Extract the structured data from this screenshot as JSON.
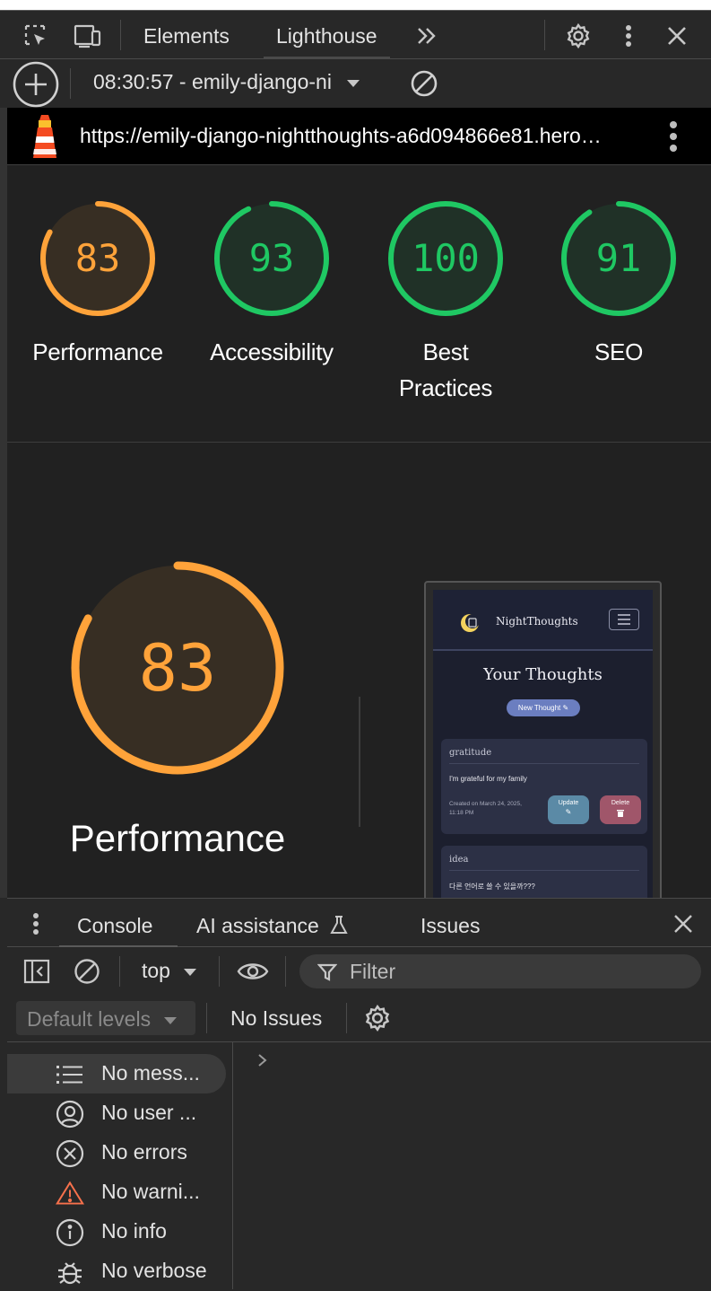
{
  "toolbar": {
    "tabs": [
      "Elements",
      "Lighthouse"
    ],
    "active_tab": "Lighthouse",
    "more_tabs": "»"
  },
  "report_bar": {
    "selected_report": "08:30:57 - emily-django-ni"
  },
  "url_bar": {
    "url": "https://emily-django-nightthoughts-a6d094866e81.hero…"
  },
  "scores": [
    {
      "value": 83,
      "label": "Performance",
      "color": "#ffa33a"
    },
    {
      "value": 93,
      "label": "Accessibility",
      "color": "#1fc863"
    },
    {
      "value": 100,
      "label": "Best Practices",
      "color": "#1fc863"
    },
    {
      "value": 91,
      "label": "SEO",
      "color": "#1fc863"
    }
  ],
  "featured": {
    "value": 83,
    "label": "Performance",
    "color": "#ffa33a"
  },
  "page_screenshot": {
    "brand": "NightThoughts",
    "title": "Your Thoughts",
    "new_button": "New Thought",
    "cards": [
      {
        "tag": "gratitude",
        "body": "I'm grateful for my family",
        "meta": "Created on March 24, 2025, 11:18 PM",
        "update_label": "Update",
        "delete_label": "Delete"
      },
      {
        "tag": "idea",
        "body": "다른 언어로 쓸 수 있을까???"
      }
    ]
  },
  "drawer": {
    "tabs": [
      "Console",
      "AI assistance",
      "Issues"
    ],
    "active_tab": "Console"
  },
  "console": {
    "context": "top",
    "filter_placeholder": "Filter",
    "levels": "Default levels",
    "issues": "No Issues",
    "prompt": ">",
    "sidebar": [
      {
        "label": "No mess...",
        "icon": "list-icon"
      },
      {
        "label": "No user ...",
        "icon": "user-icon"
      },
      {
        "label": "No errors",
        "icon": "error-icon"
      },
      {
        "label": "No warni...",
        "icon": "warning-icon"
      },
      {
        "label": "No info",
        "icon": "info-icon"
      },
      {
        "label": "No verbose",
        "icon": "bug-icon"
      }
    ]
  }
}
